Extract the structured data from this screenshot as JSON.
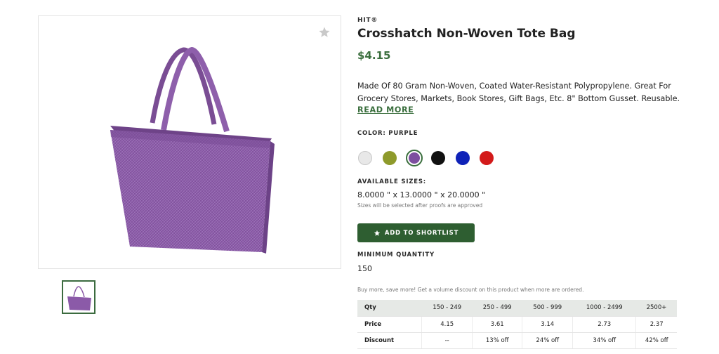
{
  "product": {
    "brand": "HIT®",
    "title": "Crosshatch Non-Woven Tote Bag",
    "price": "$4.15",
    "description_lines": [
      "Made Of 80 Gram Non-Woven, Coated Water-Resistant Polypropylene. Great For",
      "Grocery Stores, Markets, Book Stores, Gift Bags, Etc. 8\" Bottom Gusset. Reusable. 2..."
    ],
    "read_more": "READ MORE"
  },
  "colors": {
    "label": "COLOR: PURPLE",
    "swatches": [
      {
        "name": "white",
        "hex": "#e8e8e8"
      },
      {
        "name": "olive",
        "hex": "#8e9a2b"
      },
      {
        "name": "purple",
        "hex": "#7d4e9f",
        "selected": true
      },
      {
        "name": "black",
        "hex": "#111111"
      },
      {
        "name": "blue",
        "hex": "#0f22b8"
      },
      {
        "name": "red",
        "hex": "#d31a1a"
      }
    ]
  },
  "sizes": {
    "label": "AVAILABLE SIZES:",
    "value": "8.0000 \" x 13.0000 \" x 20.0000 \"",
    "note": "Sizes will be selected after proofs are approved"
  },
  "shortlist_button": {
    "label": "ADD TO SHORTLIST",
    "icon": "star-icon"
  },
  "minimum_quantity": {
    "label": "MINIMUM QUANTITY",
    "value": "150"
  },
  "pricing": {
    "note": "Buy more, save more! Get a volume discount on this product when more are ordered.",
    "headers": [
      "Qty",
      "150 - 249",
      "250 - 499",
      "500 - 999",
      "1000 - 2499",
      "2500+"
    ],
    "price_row": [
      "Price",
      "4.15",
      "3.61",
      "3.14",
      "2.73",
      "2.37"
    ],
    "discount_row": [
      "Discount",
      "--",
      "13% off",
      "24% off",
      "34% off",
      "42% off"
    ]
  },
  "theme": {
    "accent": "#3a6e3d",
    "button": "#2e5e31",
    "bag_color": "#8a5aa6"
  },
  "icons": {
    "favorite": "star-outline-icon",
    "product_image": "tote-bag-image"
  }
}
